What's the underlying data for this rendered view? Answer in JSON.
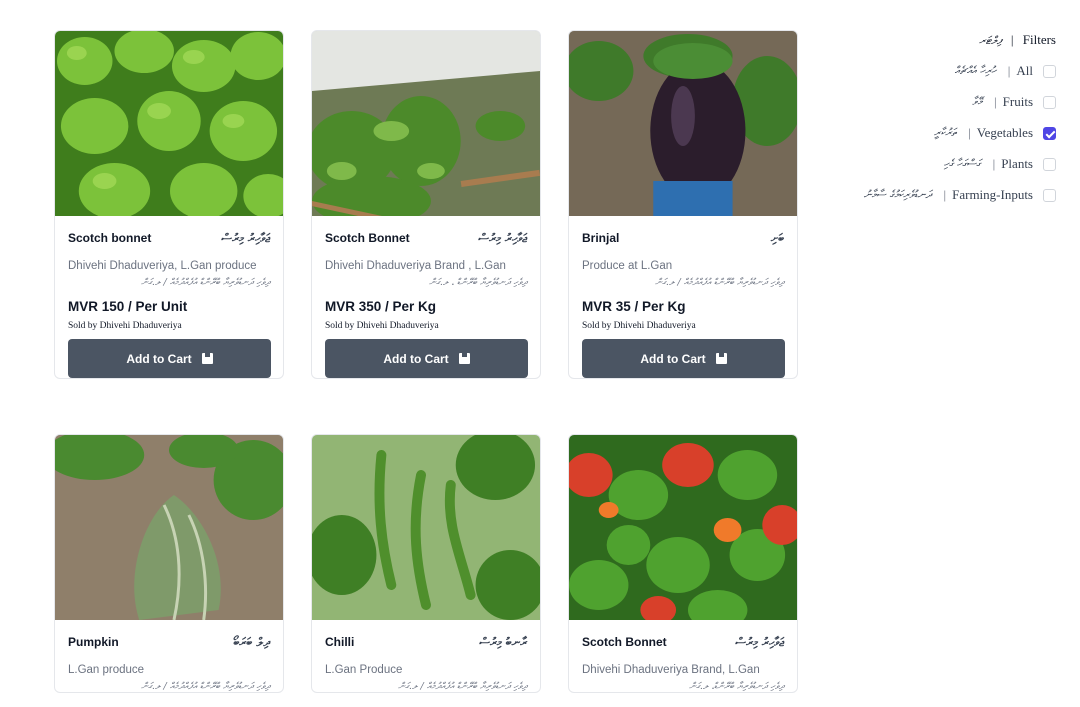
{
  "filters": {
    "title_dv": "ފިލްޓަރ",
    "title_en": "Filters",
    "items": [
      {
        "dv": "ހުރިހާ އެއްޗެއް",
        "en": "All",
        "checked": false
      },
      {
        "dv": "މޭވާ",
        "en": "Fruits",
        "checked": false
      },
      {
        "dv": "ތަރުކާރީ",
        "en": "Vegetables",
        "checked": true
      },
      {
        "dv": "ގަސްގަހާ ގެހި",
        "en": "Plants",
        "checked": false
      },
      {
        "dv": "ދަނޑުވެރިކަމުގެ ސާމާނު",
        "en": "Farming-Inputs",
        "checked": false
      }
    ]
  },
  "products": [
    {
      "name_en": "Scotch bonnet",
      "name_dv": "ޖަވާހިރު މިރުސް",
      "origin_en": "Dhivehi Dhaduveriya, L.Gan produce",
      "origin_dv": "ދިވެހި ދަނޑުވެރިޔާ ބްރޭންޑް އުފެއްދުމެއް / ލ.ގަން",
      "price": "MVR 150 / Per Unit",
      "sold_by": "Sold  by  Dhivehi  Dhaduveriya",
      "button": "Add to Cart",
      "image": "green scotch bonnet peppers"
    },
    {
      "name_en": "Scotch Bonnet",
      "name_dv": "ޖަވާހިރު މިރުސް",
      "origin_en": "Dhivehi Dhaduveriya Brand , L.Gan",
      "origin_dv": "ދިވެހި ދަނޑުވެރިޔާ ބްރޭންޑް ، ލ.ގަން",
      "price": "MVR 350 / Per Kg",
      "sold_by": "Sold  by  Dhivehi  Dhaduveriya",
      "button": "Add to Cart",
      "image": "pepper plants in greenhouse"
    },
    {
      "name_en": "Brinjal",
      "name_dv": "ބަށި",
      "origin_en": "Produce at L.Gan",
      "origin_dv": "ދިވެހި ދަނޑުވެރިޔާ ބްރޭންޑް އުފެއްދުމެއް / ލ.ގަން",
      "price": "MVR 35 / Per Kg",
      "sold_by": "Sold  by  Dhivehi  Dhaduveriya",
      "button": "Add to Cart",
      "image": "purple brinjal on plant"
    },
    {
      "name_en": "Pumpkin",
      "name_dv": "ދިލް ބަރަބޯ",
      "origin_en": "L.Gan produce",
      "origin_dv": "ދިވެހި ދަނޑުވެރިޔާ ބްރޭންޑް އުފެއްދުމެއް / ލ.ގަން",
      "image": "green pumpkin on ground"
    },
    {
      "name_en": "Chilli",
      "name_dv": "ރާނބު މިރުސް",
      "origin_en": "L.Gan Produce",
      "origin_dv": "ދިވެހި ދަނޑުވެރިޔާ ބްރޭންޑް އުފެއްދުމެއް / ލ.ގަން",
      "image": "green chillies on plant"
    },
    {
      "name_en": "Scotch Bonnet",
      "name_dv": "ޖަވާހިރު މިރުސް",
      "origin_en": "Dhivehi Dhaduveriya Brand, L.Gan",
      "origin_dv": "ދިވެހި ދަނޑުވެރިޔާ ބްރޭންޑް، ލ.ގަން",
      "image": "red and green scotch bonnets"
    }
  ],
  "colors": {
    "button": "#4b5563",
    "checkbox_checked": "#4f46e5",
    "border": "#e5e7eb"
  }
}
